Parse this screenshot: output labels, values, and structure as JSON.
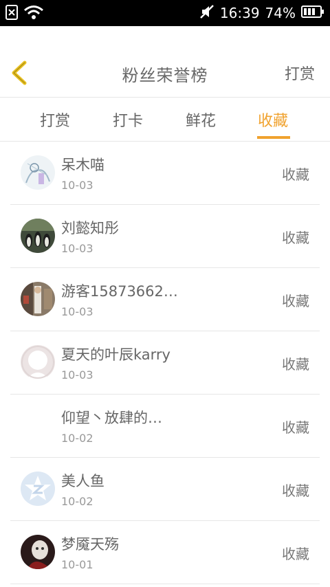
{
  "status_bar": {
    "time": "16:39",
    "battery": "74%",
    "icons": [
      "sim-x-icon",
      "wifi-icon",
      "mute-icon",
      "battery-icon"
    ]
  },
  "header": {
    "title": "粉丝荣誉榜",
    "action_label": "打赏",
    "back_icon": "chevron-left-icon",
    "back_color": "#e8c020"
  },
  "tabs": [
    {
      "label": "打赏",
      "active": false
    },
    {
      "label": "打卡",
      "active": false
    },
    {
      "label": "鲜花",
      "active": false
    },
    {
      "label": "收藏",
      "active": true
    }
  ],
  "accent_color": "#f0a22e",
  "fans": [
    {
      "name": "呆木喵",
      "date": "10-03",
      "action": "收藏",
      "avatar": "sketch-avatar"
    },
    {
      "name": "刘懿知彤",
      "date": "10-03",
      "action": "收藏",
      "avatar": "penguins-avatar"
    },
    {
      "name": "游客15873662…",
      "date": "10-03",
      "action": "收藏",
      "avatar": "photo-avatar"
    },
    {
      "name": "夏天的叶辰karry",
      "date": "10-03",
      "action": "收藏",
      "avatar": "default-avatar"
    },
    {
      "name": "仰望丶放肆的…",
      "date": "10-02",
      "action": "收藏",
      "avatar": "none"
    },
    {
      "name": "美人鱼",
      "date": "10-02",
      "action": "收藏",
      "avatar": "qq-zone-avatar"
    },
    {
      "name": "梦魇天殇",
      "date": "10-01",
      "action": "收藏",
      "avatar": "dark-photo-avatar"
    }
  ]
}
